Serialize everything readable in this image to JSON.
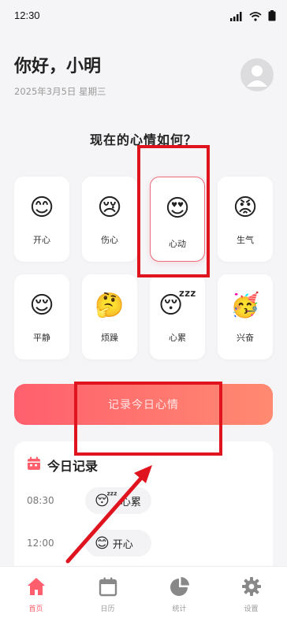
{
  "status_bar": {
    "time": "12:30"
  },
  "header": {
    "greeting": "你好，小明",
    "date": "2025年3月5日 星期三"
  },
  "question": "现在的心情如何？",
  "moods": [
    {
      "emoji": "😊",
      "label": "开心"
    },
    {
      "emoji": "😢",
      "label": "伤心"
    },
    {
      "emoji": "😍",
      "label": "心动",
      "selected": true
    },
    {
      "emoji": "😡",
      "label": "生气"
    },
    {
      "emoji": "😌",
      "label": "平静"
    },
    {
      "emoji": "🤔",
      "label": "烦躁"
    },
    {
      "emoji": "😴",
      "label": "心累"
    },
    {
      "emoji": "🥳",
      "label": "兴奋"
    }
  ],
  "record_button": {
    "label": "记录今日心情"
  },
  "records": {
    "title": "今日记录",
    "items": [
      {
        "time": "08:30",
        "emoji": "😴",
        "label": "心累"
      },
      {
        "time": "12:00",
        "emoji": "😊",
        "label": "开心"
      }
    ]
  },
  "bottom_nav": [
    {
      "label": "首页",
      "icon": "home-icon",
      "active": true
    },
    {
      "label": "日历",
      "icon": "calendar-icon"
    },
    {
      "label": "统计",
      "icon": "pie-chart-icon"
    },
    {
      "label": "设置",
      "icon": "gear-icon"
    }
  ],
  "colors": {
    "accent": "#ff5f6d",
    "accent_end": "#ff8a71",
    "annotation": "#e0141e",
    "selected_border": "#ef6a7a"
  }
}
